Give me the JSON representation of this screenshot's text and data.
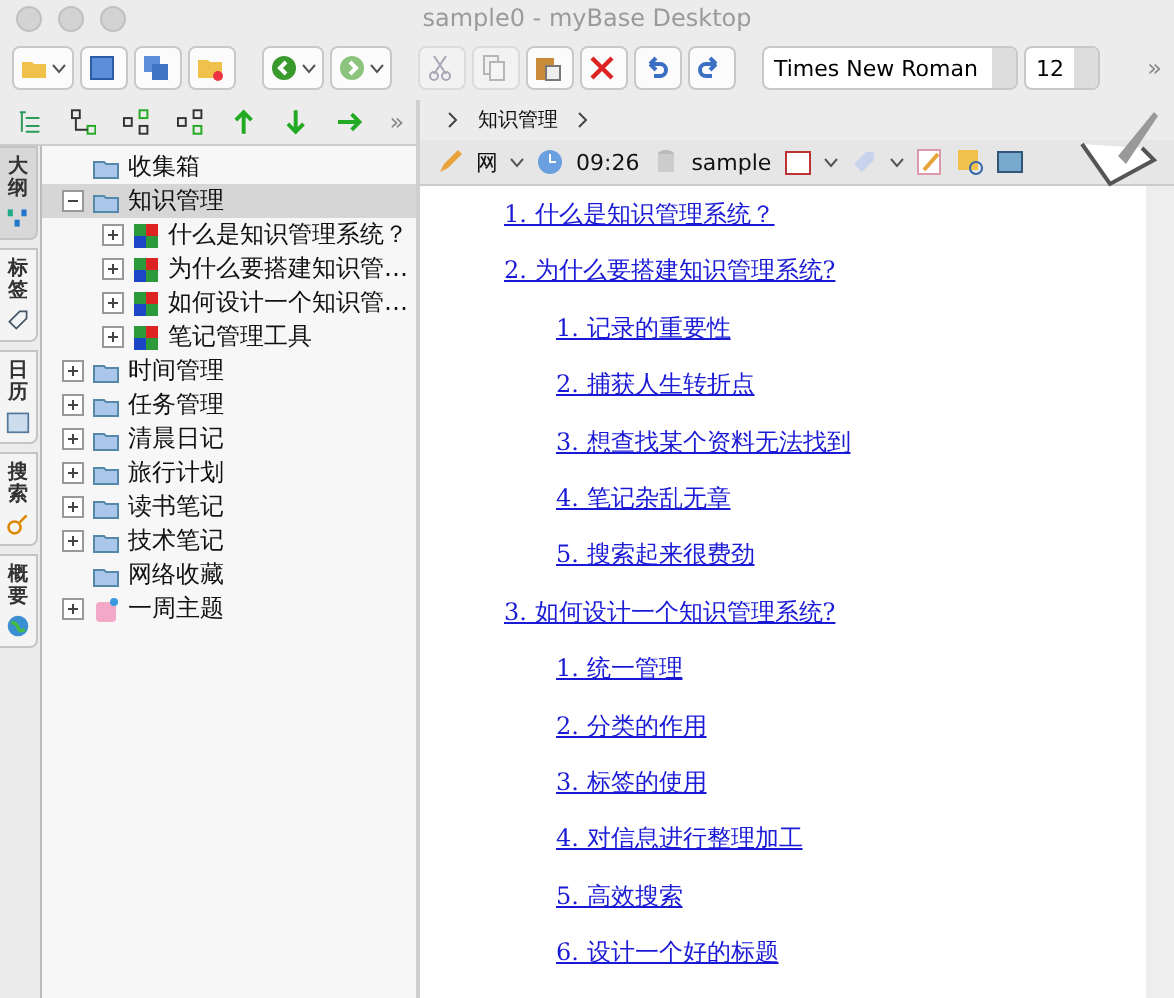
{
  "window": {
    "title": "sample0 - myBase Desktop"
  },
  "toolbar": {
    "buttons": [
      {
        "kind": "open",
        "disabled": false,
        "menu": true
      },
      {
        "kind": "save",
        "disabled": false,
        "menu": false
      },
      {
        "kind": "saveall",
        "disabled": false,
        "menu": false
      },
      {
        "kind": "close",
        "disabled": false,
        "menu": false
      },
      {
        "kind": "back",
        "disabled": false,
        "menu": true
      },
      {
        "kind": "forward",
        "disabled": false,
        "menu": true
      },
      {
        "kind": "cut",
        "disabled": true,
        "menu": false
      },
      {
        "kind": "copy",
        "disabled": true,
        "menu": false
      },
      {
        "kind": "paste",
        "disabled": false,
        "menu": false
      },
      {
        "kind": "delete",
        "disabled": false,
        "menu": false
      },
      {
        "kind": "undo",
        "disabled": false,
        "menu": false
      },
      {
        "kind": "redo",
        "disabled": false,
        "menu": false
      }
    ],
    "font": "Times New Roman",
    "size": "12",
    "more": "»"
  },
  "side_tabs": [
    {
      "label": "大纲",
      "selected": true
    },
    {
      "label": "标签",
      "selected": false
    },
    {
      "label": "日历",
      "selected": false
    },
    {
      "label": "搜索",
      "selected": false
    },
    {
      "label": "概要",
      "selected": false
    }
  ],
  "tree_toolbar": {
    "more": "»"
  },
  "tree": [
    {
      "label": "收集箱",
      "kind": "folder",
      "leaf": true,
      "expanded": false,
      "selected": false
    },
    {
      "label": "知识管理",
      "kind": "folder",
      "leaf": false,
      "expanded": true,
      "selected": true,
      "children": [
        {
          "label": "什么是知识管理系统？",
          "kind": "note",
          "leaf": false,
          "expanded": false,
          "selected": false
        },
        {
          "label": "为什么要搭建知识管…",
          "kind": "note",
          "leaf": false,
          "expanded": false,
          "selected": false
        },
        {
          "label": "如何设计一个知识管…",
          "kind": "note",
          "leaf": false,
          "expanded": false,
          "selected": false
        },
        {
          "label": "笔记管理工具",
          "kind": "note",
          "leaf": false,
          "expanded": false,
          "selected": false
        }
      ]
    },
    {
      "label": "时间管理",
      "kind": "folder",
      "leaf": false,
      "expanded": false,
      "selected": false
    },
    {
      "label": "任务管理",
      "kind": "folder",
      "leaf": false,
      "expanded": false,
      "selected": false
    },
    {
      "label": "清晨日记",
      "kind": "folder",
      "leaf": false,
      "expanded": false,
      "selected": false
    },
    {
      "label": "旅行计划",
      "kind": "folder",
      "leaf": false,
      "expanded": false,
      "selected": false
    },
    {
      "label": "读书笔记",
      "kind": "folder",
      "leaf": false,
      "expanded": false,
      "selected": false
    },
    {
      "label": "技术笔记",
      "kind": "folder",
      "leaf": false,
      "expanded": false,
      "selected": false
    },
    {
      "label": "网络收藏",
      "kind": "folder",
      "leaf": true,
      "expanded": false,
      "selected": false
    },
    {
      "label": "一周主题",
      "kind": "topic",
      "leaf": false,
      "expanded": false,
      "selected": false
    }
  ],
  "breadcrumb": [
    "知识管理"
  ],
  "doc_toolbar": {
    "format": "网",
    "time": "09:26",
    "database": "sample"
  },
  "content": [
    {
      "text": "1. 什么是知识管理系统？"
    },
    {
      "text": "2. 为什么要搭建知识管理系统?",
      "children": [
        {
          "text": "1. 记录的重要性"
        },
        {
          "text": "2. 捕获人生转折点"
        },
        {
          "text": "3. 想查找某个资料无法找到"
        },
        {
          "text": "4. 笔记杂乱无章"
        },
        {
          "text": "5. 搜索起来很费劲"
        }
      ]
    },
    {
      "text": "3. 如何设计一个知识管理系统?",
      "children": [
        {
          "text": "1. 统一管理"
        },
        {
          "text": "2. 分类的作用"
        },
        {
          "text": "3. 标签的使用"
        },
        {
          "text": "4. 对信息进行整理加工"
        },
        {
          "text": "5. 高效搜索"
        },
        {
          "text": "6. 设计一个好的标题"
        }
      ]
    }
  ]
}
